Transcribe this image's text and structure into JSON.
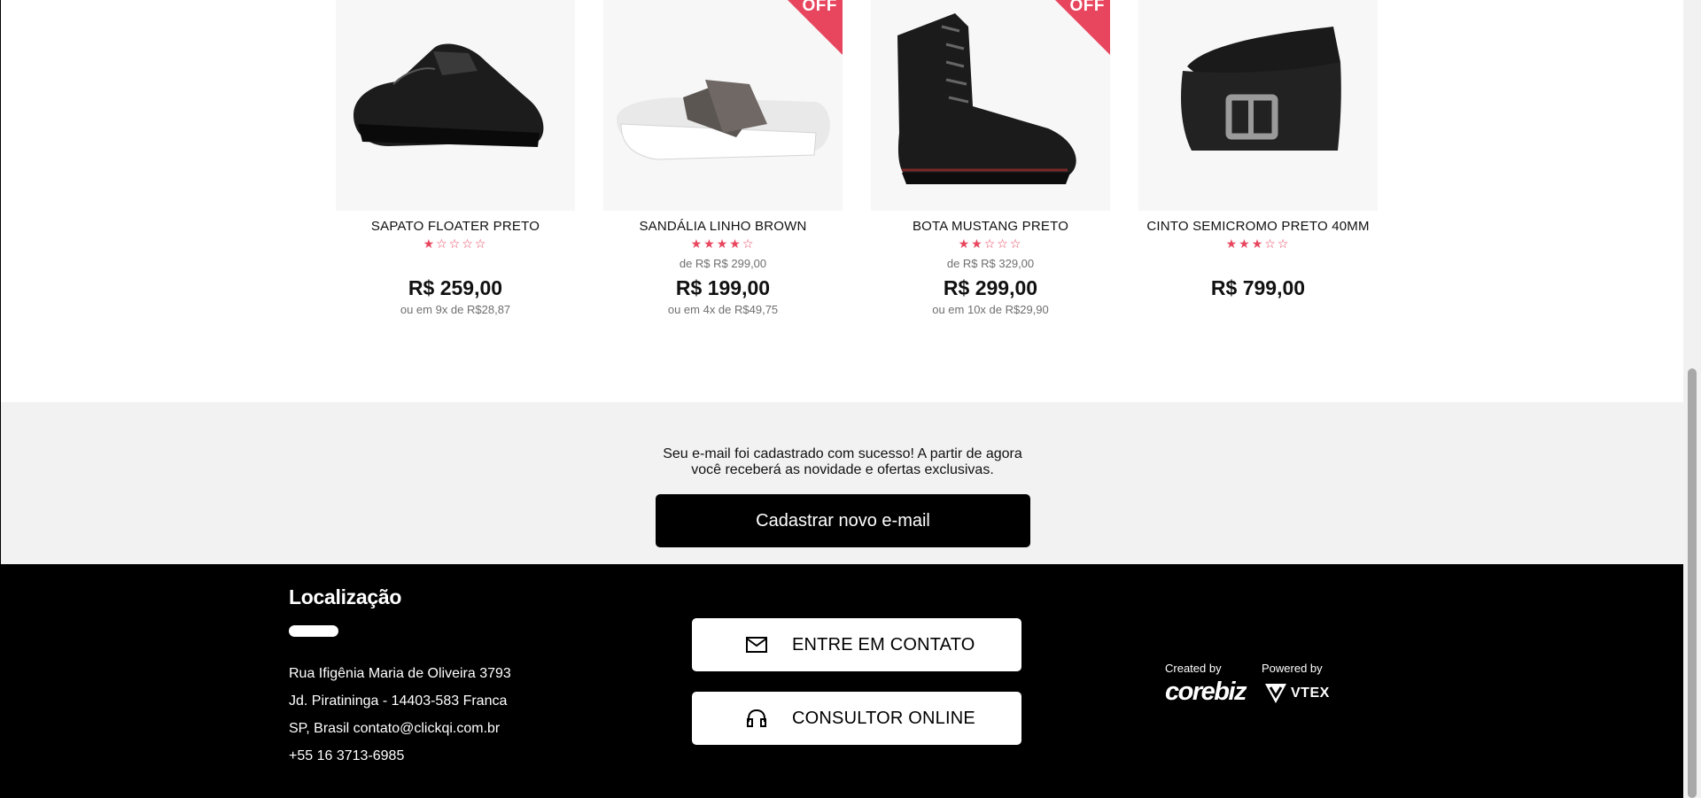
{
  "products": [
    {
      "name": "SAPATO FLOATER PRETO",
      "rating": 1,
      "old_price": "",
      "price": "R$ 259,00",
      "installments": "ou em 9x de R$28,87",
      "off_badge": ""
    },
    {
      "name": "SANDÁLIA LINHO BROWN",
      "rating": 4,
      "old_price": "de R$ R$ 299,00",
      "price": "R$ 199,00",
      "installments": "ou em 4x de R$49,75",
      "off_badge": "OFF"
    },
    {
      "name": "BOTA MUSTANG PRETO",
      "rating": 2,
      "old_price": "de R$ R$ 329,00",
      "price": "R$ 299,00",
      "installments": "ou em 10x de R$29,90",
      "off_badge": "OFF"
    },
    {
      "name": "CINTO SEMICROMO PRETO 40MM",
      "rating": 3,
      "old_price": "",
      "price": "R$ 799,00",
      "installments": "",
      "off_badge": ""
    }
  ],
  "newsletter": {
    "message": "Seu e-mail foi cadastrado com sucesso! A partir de agora você receberá as novidade e ofertas exclusivas.",
    "button": "Cadastrar novo e-mail"
  },
  "footer": {
    "location_title": "Localização",
    "address_lines": [
      "Rua Ifigênia Maria de Oliveira 3793",
      "Jd. Piratininga - 14403-583 Franca",
      "SP, Brasil contato@clickqi.com.br",
      "+55 16 3713-6985"
    ],
    "contact_button": "ENTRE EM CONTATO",
    "consultant_button": "CONSULTOR ONLINE",
    "created_by": "Created by",
    "powered_by": "Powered by",
    "corebiz": "corebiz",
    "vtex": "VTEX"
  },
  "colors": {
    "accent": "#e8455e",
    "footer_bg": "#000000",
    "newsletter_bg": "#f2f2f2"
  },
  "icons": {
    "contact": "mail-icon",
    "consultant": "headset-icon",
    "vtex": "vtex-logo-icon"
  }
}
